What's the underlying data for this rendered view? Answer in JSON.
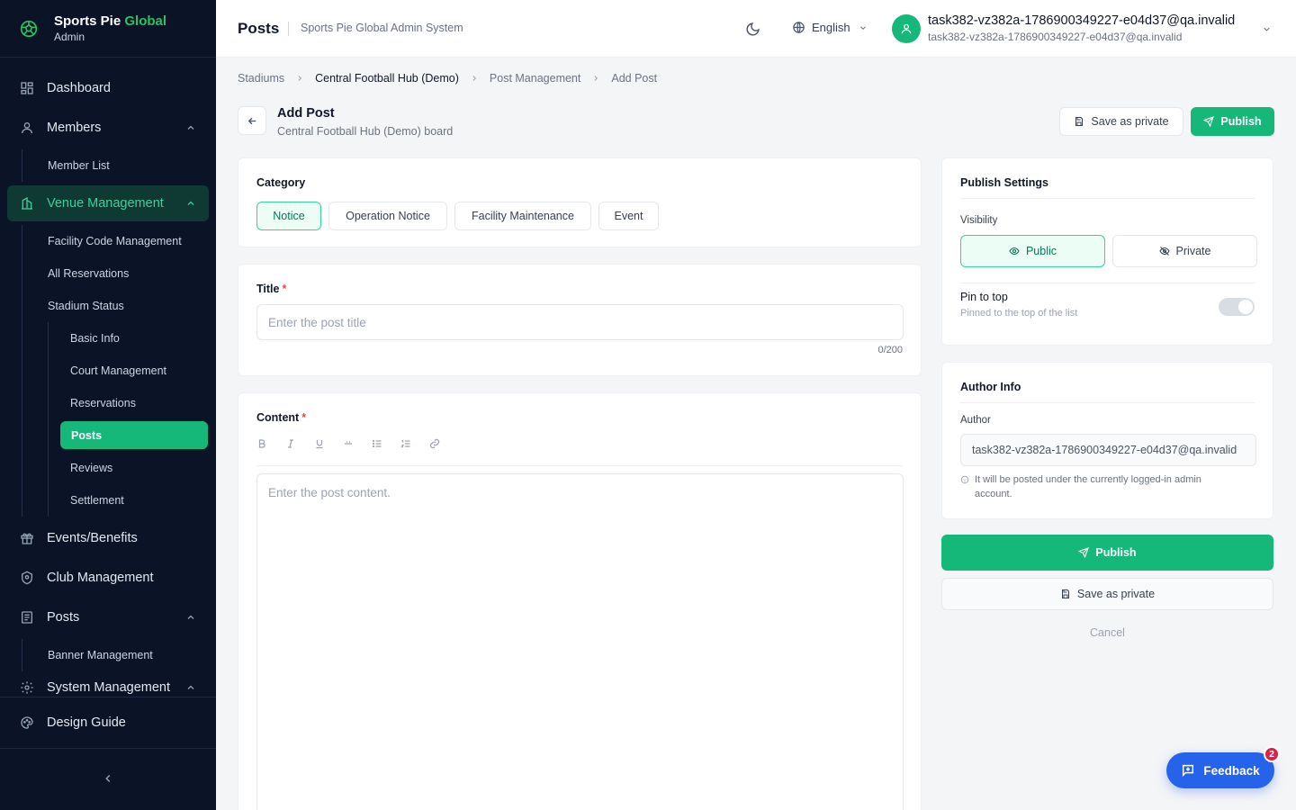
{
  "brand": {
    "name_main": "Sports Pie",
    "name_accent": "Global",
    "role": "Admin"
  },
  "sidebar": {
    "dashboard": "Dashboard",
    "members": "Members",
    "member_list": "Member List",
    "venue_management": "Venue Management",
    "facility_code": "Facility Code Management",
    "all_reservations": "All Reservations",
    "stadium_status": "Stadium Status",
    "basic_info": "Basic Info",
    "court_management": "Court Management",
    "reservations": "Reservations",
    "posts_sub": "Posts",
    "reviews": "Reviews",
    "settlement": "Settlement",
    "events_benefits": "Events/Benefits",
    "club_management": "Club Management",
    "posts": "Posts",
    "banner_management": "Banner Management",
    "system_management": "System Management",
    "design_guide": "Design Guide"
  },
  "topbar": {
    "title": "Posts",
    "subtitle": "Sports Pie Global Admin System",
    "language": "English",
    "user_name": "task382-vz382a-1786900349227-e04d37@qa.invalid",
    "user_email": "task382-vz382a-1786900349227-e04d37@qa.invalid"
  },
  "breadcrumb": [
    "Stadiums",
    "Central Football Hub (Demo)",
    "Post Management",
    "Add Post"
  ],
  "header": {
    "title": "Add Post",
    "subtitle": "Central Football Hub (Demo) board",
    "save_private": "Save as private",
    "publish": "Publish"
  },
  "category": {
    "label": "Category",
    "options": [
      "Notice",
      "Operation Notice",
      "Facility Maintenance",
      "Event"
    ],
    "selected": "Notice"
  },
  "title_field": {
    "label": "Title",
    "placeholder": "Enter the post title",
    "counter": "0/200"
  },
  "content_field": {
    "label": "Content",
    "placeholder": "Enter the post content."
  },
  "publish_settings": {
    "title": "Publish Settings",
    "visibility_label": "Visibility",
    "public": "Public",
    "private": "Private",
    "pin_label": "Pin to top",
    "pin_desc": "Pinned to the top of the list",
    "pin_enabled": false
  },
  "author_info": {
    "title": "Author Info",
    "author_label": "Author",
    "author_value": "task382-vz382a-1786900349227-e04d37@qa.invalid",
    "hint": "It will be posted under the currently logged-in admin account."
  },
  "actions": {
    "publish": "Publish",
    "save_private": "Save as private",
    "cancel": "Cancel"
  },
  "feedback": {
    "label": "Feedback",
    "badge": "2"
  },
  "colors": {
    "accent": "#16b87a",
    "sidebar_bg": "#0b1426",
    "feedback": "#2563eb",
    "badge": "#e11d48"
  }
}
